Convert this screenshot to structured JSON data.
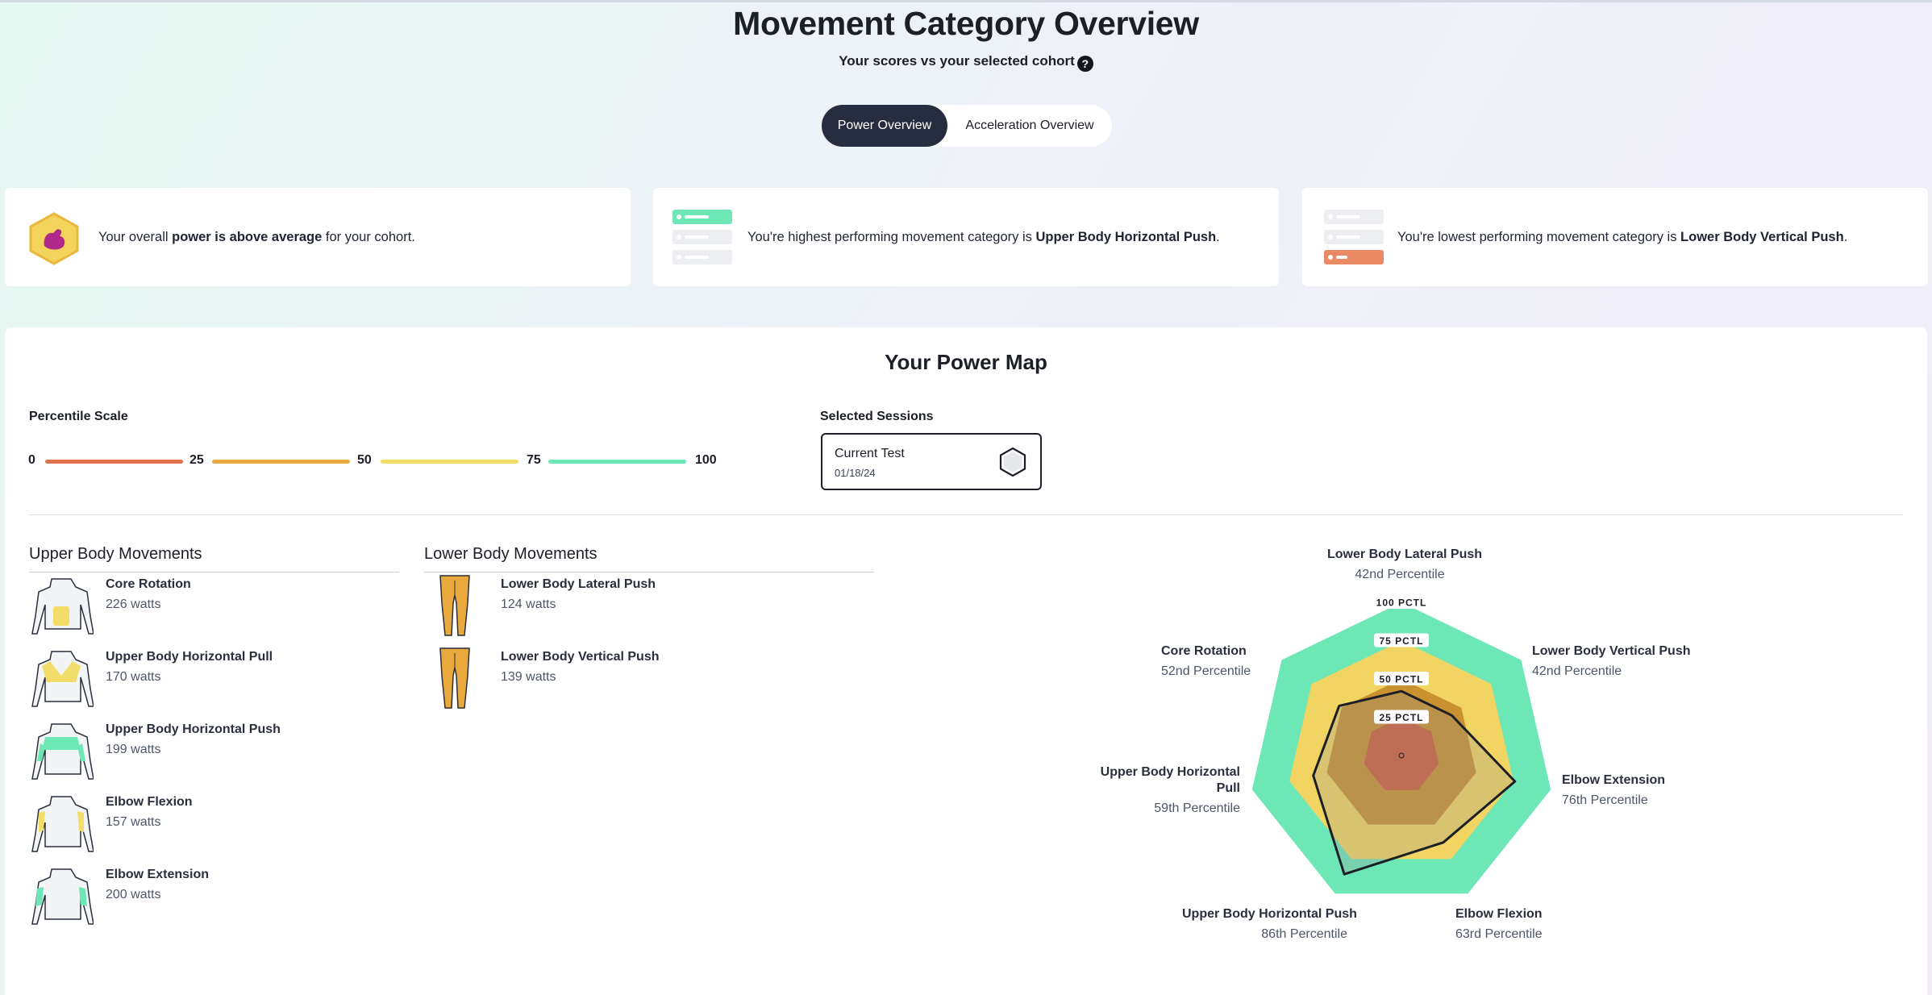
{
  "header": {
    "title": "Movement Category Overview",
    "subtitle": "Your scores vs your selected cohort",
    "help_icon": "question-circle-icon"
  },
  "toggle": {
    "options": [
      "Power Overview",
      "Acceleration Overview"
    ],
    "selected": "Power Overview"
  },
  "insights": [
    {
      "icon": "flexed-arm-badge-icon",
      "text_before": "Your overall ",
      "bold": "power is above average",
      "text_after": " for your cohort."
    },
    {
      "icon": "top-ranked-list-icon",
      "text_before": "You're highest performing movement category is ",
      "bold": "Upper Body Horizontal Push",
      "text_after": "."
    },
    {
      "icon": "bottom-ranked-list-icon",
      "text_before": "You're lowest performing movement category is ",
      "bold": "Lower Body Vertical Push",
      "text_after": "."
    }
  ],
  "power_map": {
    "title": "Your Power Map",
    "percentile_scale": {
      "label": "Percentile Scale",
      "ticks": [
        "0",
        "25",
        "50",
        "75",
        "100"
      ],
      "colors": [
        "#e0734e",
        "#e9a93d",
        "#f2dc6a",
        "#6ee7b7"
      ]
    },
    "sessions": {
      "label": "Selected Sessions",
      "current": {
        "name": "Current Test",
        "date": "01/18/24"
      }
    },
    "upper_body": {
      "heading": "Upper Body Movements",
      "items": [
        {
          "name": "Core Rotation",
          "value": "226 watts",
          "color": "#f2dc6a"
        },
        {
          "name": "Upper Body Horizontal Pull",
          "value": "170 watts",
          "color": "#f2dc6a"
        },
        {
          "name": "Upper Body Horizontal Push",
          "value": "199 watts",
          "color": "#6ee7b7"
        },
        {
          "name": "Elbow Flexion",
          "value": "157 watts",
          "color": "#f2dc6a"
        },
        {
          "name": "Elbow Extension",
          "value": "200 watts",
          "color": "#6ee7b7"
        }
      ]
    },
    "lower_body": {
      "heading": "Lower Body Movements",
      "items": [
        {
          "name": "Lower Body Lateral Push",
          "value": "124 watts",
          "color": "#e9a93d"
        },
        {
          "name": "Lower Body Vertical Push",
          "value": "139 watts",
          "color": "#e9a93d"
        }
      ]
    },
    "radar": {
      "ring_labels": [
        "100 PCTL",
        "75 PCTL",
        "50 PCTL",
        "25 PCTL"
      ],
      "axes": [
        {
          "name": "Lower Body Lateral Push",
          "percentile_text": "42nd Percentile",
          "percentile": 42
        },
        {
          "name": "Lower Body Vertical Push",
          "percentile_text": "42nd Percentile",
          "percentile": 42
        },
        {
          "name": "Elbow Extension",
          "percentile_text": "76th Percentile",
          "percentile": 76
        },
        {
          "name": "Elbow Flexion",
          "percentile_text": "63rd Percentile",
          "percentile": 63
        },
        {
          "name": "Upper Body Horizontal Push",
          "percentile_text": "86th Percentile",
          "percentile": 86
        },
        {
          "name": "Upper Body Horizontal Pull",
          "percentile_text": "59th Percentile",
          "percentile": 59
        },
        {
          "name": "Core Rotation",
          "percentile_text": "52nd Percentile",
          "percentile": 52
        }
      ]
    }
  }
}
